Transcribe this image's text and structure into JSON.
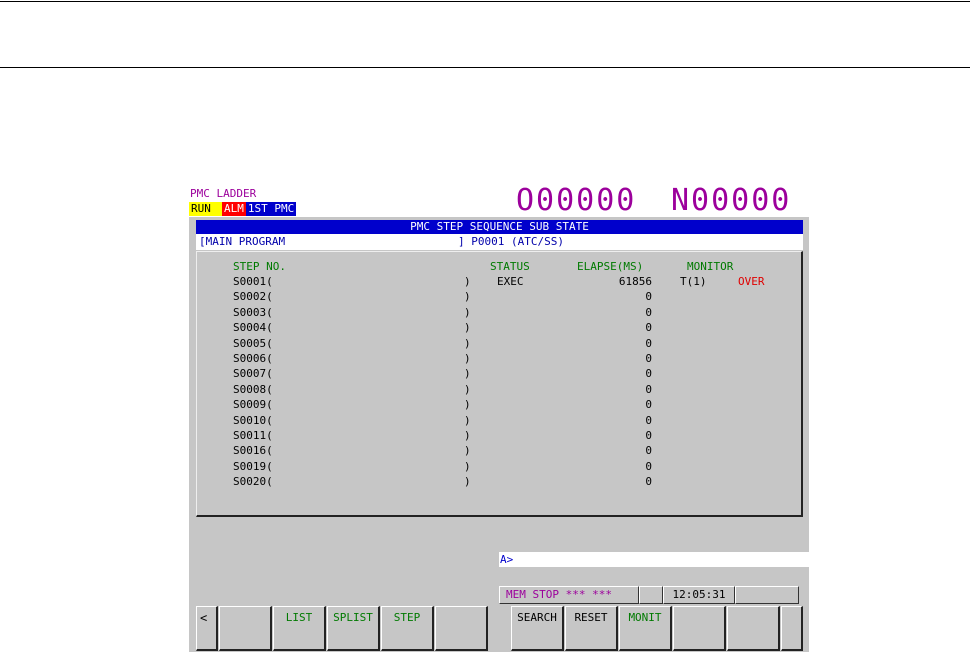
{
  "header": {
    "title": "PMC LADDER",
    "badges": {
      "run": "RUN",
      "alm": "ALM",
      "pmc": "1ST PMC"
    },
    "program_number": "O00000",
    "sequence_number": "N00000"
  },
  "title_bar": "PMC STEP SEQUENCE SUB STATE",
  "program_bar": {
    "left": "[MAIN PROGRAM",
    "right": "] P0001 (ATC/SS)"
  },
  "columns": {
    "step": "STEP NO.",
    "status": "STATUS",
    "elapse": "ELAPSE(MS)",
    "monitor": "MONITOR"
  },
  "rows": [
    {
      "step": "S0001(",
      "close": ")",
      "status": "EXEC",
      "elapse": "61856",
      "monitor": "T(1)",
      "flag": "OVER"
    },
    {
      "step": "S0002(",
      "close": ")",
      "status": "",
      "elapse": "0",
      "monitor": "",
      "flag": ""
    },
    {
      "step": "S0003(",
      "close": ")",
      "status": "",
      "elapse": "0",
      "monitor": "",
      "flag": ""
    },
    {
      "step": "S0004(",
      "close": ")",
      "status": "",
      "elapse": "0",
      "monitor": "",
      "flag": ""
    },
    {
      "step": "S0005(",
      "close": ")",
      "status": "",
      "elapse": "0",
      "monitor": "",
      "flag": ""
    },
    {
      "step": "S0006(",
      "close": ")",
      "status": "",
      "elapse": "0",
      "monitor": "",
      "flag": ""
    },
    {
      "step": "S0007(",
      "close": ")",
      "status": "",
      "elapse": "0",
      "monitor": "",
      "flag": ""
    },
    {
      "step": "S0008(",
      "close": ")",
      "status": "",
      "elapse": "0",
      "monitor": "",
      "flag": ""
    },
    {
      "step": "S0009(",
      "close": ")",
      "status": "",
      "elapse": "0",
      "monitor": "",
      "flag": ""
    },
    {
      "step": "S0010(",
      "close": ")",
      "status": "",
      "elapse": "0",
      "monitor": "",
      "flag": ""
    },
    {
      "step": "S0011(",
      "close": ")",
      "status": "",
      "elapse": "0",
      "monitor": "",
      "flag": ""
    },
    {
      "step": "S0016(",
      "close": ")",
      "status": "",
      "elapse": "0",
      "monitor": "",
      "flag": ""
    },
    {
      "step": "S0019(",
      "close": ")",
      "status": "",
      "elapse": "0",
      "monitor": "",
      "flag": ""
    },
    {
      "step": "S0020(",
      "close": ")",
      "status": "",
      "elapse": "0",
      "monitor": "",
      "flag": ""
    }
  ],
  "input_prompt": "A>",
  "status_bar": {
    "mode": "MEM  STOP",
    "stars": "*** ***",
    "clock": "12:05:31"
  },
  "softkeys": {
    "prev": "<",
    "k1": "",
    "list": "LIST",
    "splist": "SPLIST",
    "step": "STEP",
    "k5": "",
    "search": "SEARCH",
    "reset": "RESET",
    "monit": "MONIT",
    "k9": "",
    "k10": "",
    "next": ""
  },
  "colors": {
    "magenta": "#9c009c",
    "title_blue": "#0000cc",
    "header_green": "#007a00",
    "alarm_red": "#e00000",
    "screen_gray": "#c6c6c6"
  }
}
